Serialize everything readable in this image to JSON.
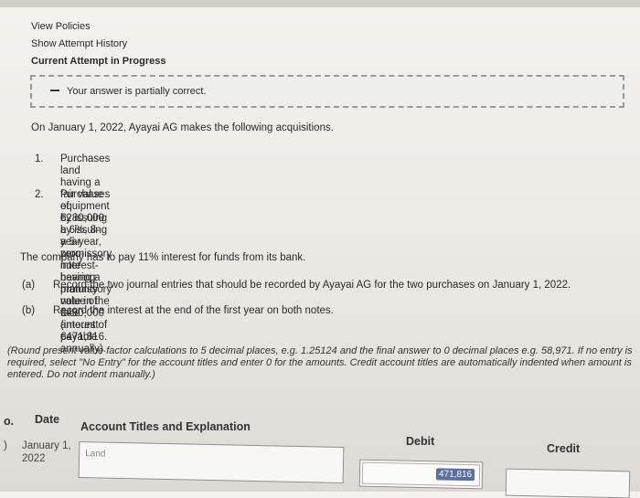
{
  "nav": {
    "view_policies": "View Policies",
    "show_attempt_history": "Show Attempt History",
    "current_attempt": "Current Attempt in Progress"
  },
  "alert": {
    "text": "Your answer is partially correct."
  },
  "problem": {
    "intro": "On January 1, 2022, Ayayai AG makes the following acquisitions.",
    "items": [
      {
        "num": "1.",
        "line1": "Purchases land having a fair value of €280,000 by issuing a 5-year, zero-interest-bearing promissory note in the face",
        "line2": "amount of €471,816."
      },
      {
        "num": "2.",
        "line1": "Purchases equipment by issuing a 6%, 8-year promissory note having a maturity value of €460,000 (interest payable",
        "line2": "annually)."
      }
    ],
    "rate_text": "The company has to pay 11% interest for funds from its bank.",
    "parts": [
      {
        "label": "(a)",
        "text": "Record the two journal entries that should be recorded by Ayayai AG for the two purchases on January 1, 2022."
      },
      {
        "label": "(b)",
        "text": "Record the interest at the end of the first year on both notes."
      }
    ],
    "note_line1": "(Round present value factor calculations to 5 decimal places, e.g. 1.25124 and the final answer to 0 decimal places e.g. 58,971. If no entry is",
    "note_line2": "required, select \"No Entry\" for the account titles and enter 0 for the amounts. Credit account titles are automatically indented when amount is",
    "note_line3": "entered. Do not indent manually.)"
  },
  "table": {
    "headers": {
      "no": "o.",
      "date": "Date",
      "account": "Account Titles and Explanation",
      "debit": "Debit",
      "credit": "Credit"
    },
    "rows": [
      {
        "no": ")",
        "date_line1": "January 1,",
        "date_line2": "2022",
        "account": "Land",
        "debit": "471,816",
        "credit": ""
      }
    ]
  }
}
